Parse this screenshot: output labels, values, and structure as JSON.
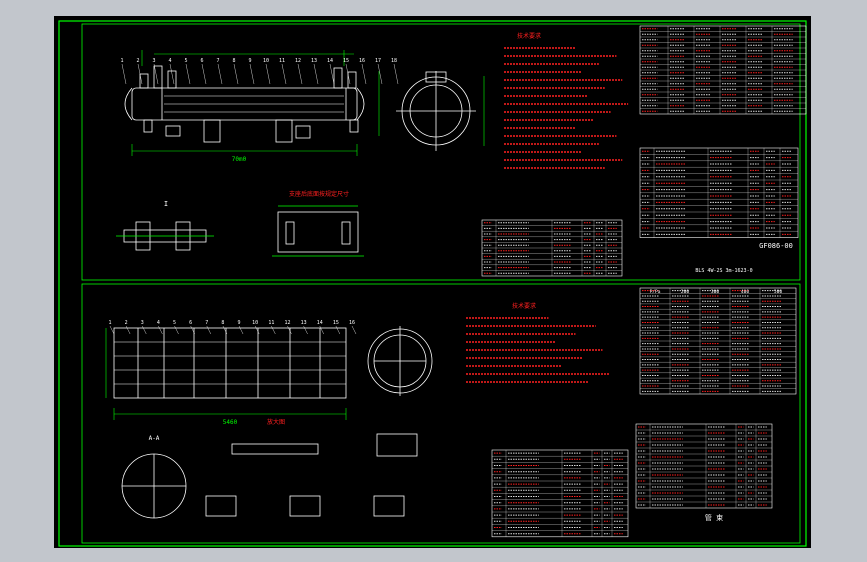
{
  "colors": {
    "background": "#c2c6cc",
    "sheet": "#000000",
    "border": "#00ff00",
    "lines": "#ffffff",
    "notes": "#ff2020",
    "dims": "#00ff00",
    "accent": "#00ffff"
  },
  "top_sheet": {
    "notes_title": "技术要求",
    "section_title": "支座后底面按规定尺寸",
    "drawing_number": "GF086-00",
    "title_block_code": "BLS 4W-2S 3m-1623-0",
    "main_dimension": "70m0",
    "callouts": [
      "1",
      "2",
      "3",
      "4",
      "5",
      "6",
      "7",
      "8",
      "9",
      "10",
      "11",
      "12",
      "13",
      "14",
      "15",
      "16",
      "17",
      "18"
    ],
    "section_label": "I"
  },
  "bottom_sheet": {
    "notes_title": "技术要求",
    "detail_title": "放大图",
    "table_top_row": [
      "P/Pa",
      "200",
      "300",
      "400",
      "500"
    ],
    "callouts": [
      "1",
      "2",
      "3",
      "4",
      "5",
      "6",
      "7",
      "8",
      "9",
      "10",
      "11",
      "12",
      "13",
      "14",
      "15",
      "16"
    ],
    "view_label": "A-A",
    "main_dimension": "5460",
    "title_stamp": "管 束",
    "sheet_number": "GF086-2-..."
  }
}
